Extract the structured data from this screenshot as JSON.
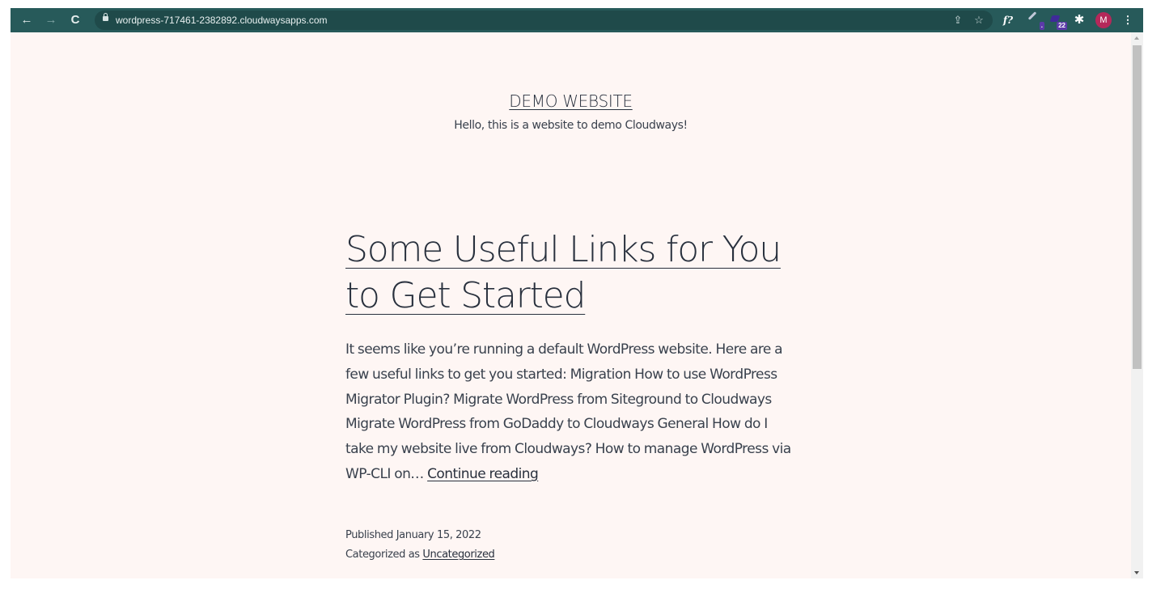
{
  "browser": {
    "url": "wordpress-717461-2382892.cloudwaysapps.com",
    "nav": {
      "back": "←",
      "forward": "→",
      "reload": "C"
    },
    "omnibox_icons": {
      "share": "⇪",
      "bookmark": "☆"
    },
    "extensions": [
      {
        "name": "fonts-ninja",
        "glyph": "f?"
      },
      {
        "name": "color-picker",
        "badge": "."
      },
      {
        "name": "graduation-cap",
        "badge": "22"
      },
      {
        "name": "puzzle",
        "glyph": "✱"
      }
    ],
    "profile_initial": "M",
    "menu_glyph": "⋮",
    "colors": {
      "toolbar": "#275a5a",
      "avatar": "#b5285a",
      "page_bg": "#fef6f4"
    },
    "scroll_position": 0.0
  },
  "site": {
    "title": "DEMO WEBSITE",
    "description": "Hello, this is a website to demo Cloudways!"
  },
  "post": {
    "title": "Some Useful Links for You to Get Started",
    "excerpt": "It seems like you’re running a default WordPress website. Here are a few useful links to get you started: Migration How to use WordPress Migrator Plugin? Migrate WordPress from Siteground to Cloudways Migrate WordPress from GoDaddy to Cloudways General How do I take my website live from Cloudways? How to manage WordPress via WP-CLI on… ",
    "continue_label": "Continue reading",
    "published_label": "Published ",
    "published_date": "January 15, 2022",
    "category_prefix": "Categorized as ",
    "category": "Uncategorized"
  }
}
